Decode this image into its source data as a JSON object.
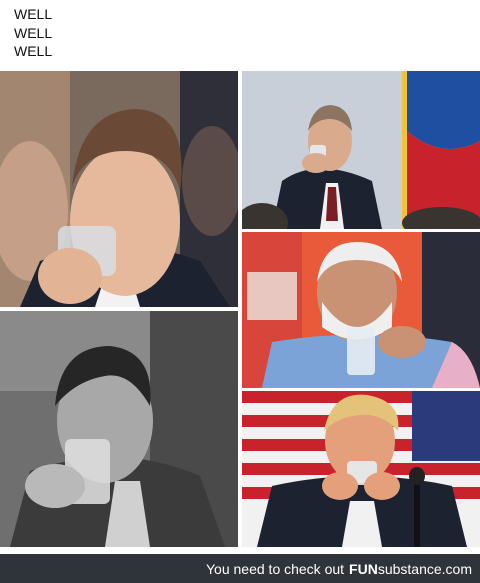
{
  "caption": {
    "lines": [
      "WELL",
      "WELL",
      "WELL"
    ]
  },
  "photos": [
    {
      "id": "top-left",
      "depicts": "man in suit drinking water from glass"
    },
    {
      "id": "top-right",
      "depicts": "man in suit drinking from glass with flag behind"
    },
    {
      "id": "middle-right",
      "depicts": "man with white beard drinking water from glass"
    },
    {
      "id": "bottom-left",
      "depicts": "black and white photo of man drinking from glass"
    },
    {
      "id": "bottom-right",
      "depicts": "man in suit drinking from glass with flag behind"
    }
  ],
  "footer": {
    "message": "You need to check out",
    "brand_bold": "FUN",
    "brand_rest": "substance.com"
  },
  "colors": {
    "footer_bg": "#2f343b",
    "flag_red": "#c8222c",
    "suit_dark": "#1d2230"
  }
}
